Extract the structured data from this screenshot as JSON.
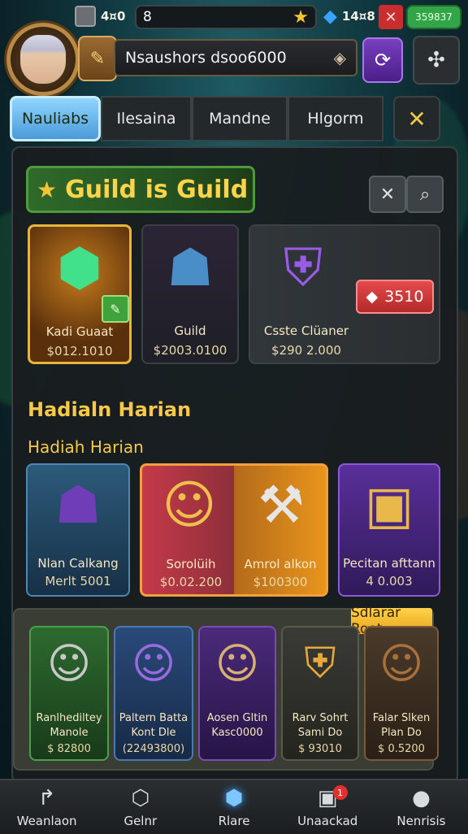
{
  "top": {
    "resource_left": "4¤0",
    "field_value": "8",
    "gems": "14¤8",
    "badge": "359837",
    "player_name": "Nsaushors dsoo6000"
  },
  "tabs": [
    "Nauliabs",
    "Ilesaina",
    "Mandne",
    "Hlgorm"
  ],
  "guild": {
    "title": "Guild is Guild",
    "cards": [
      {
        "title": "Kadi Guaat",
        "price": "$012.1010"
      },
      {
        "title": "Guild",
        "price": "$2003.0100"
      },
      {
        "title": "Csste Clüaner",
        "price": "$290 2.000"
      }
    ]
  },
  "section": {
    "heading": "Hadialn Harian",
    "subheading": "Hadiah Harian",
    "gem_count": "3510",
    "cards": [
      {
        "title": "Nlan Calkang",
        "price": "Merlt 5001"
      },
      {
        "title": "Sorolüih",
        "price": "$0.02.200"
      },
      {
        "title": "Amrol alkon",
        "price": "$100300"
      },
      {
        "title": "Pecitan afttann",
        "price": "4 0.003"
      }
    ]
  },
  "strip": {
    "label": "Sdlarar Root",
    "cards": [
      {
        "title": "Ranlhediltey",
        "sub": "Manole",
        "price": "$ 82800"
      },
      {
        "title": "Paltern Batta",
        "sub": "Kont Dle",
        "price": "(22493800)"
      },
      {
        "title": "Aosen Gltin",
        "sub": "Kasc0000",
        "price": ""
      },
      {
        "title": "Rarv Sohrt",
        "sub": "Sami Do",
        "price": "$ 93010"
      },
      {
        "title": "Falar Slken",
        "sub": "Plan Do",
        "price": "$ 0.5200"
      }
    ]
  },
  "nav": [
    {
      "label": "Weanlaon"
    },
    {
      "label": "Gelnr"
    },
    {
      "label": "Rlare"
    },
    {
      "label": "Unaackad",
      "badge": "1"
    },
    {
      "label": "Nenrisis"
    }
  ]
}
